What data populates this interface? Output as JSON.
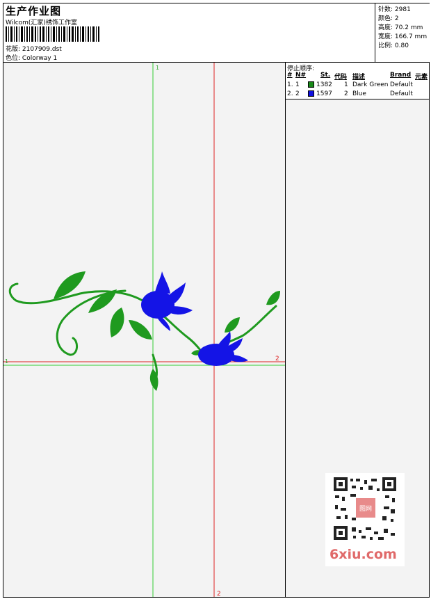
{
  "header": {
    "title": "生产作业图",
    "company": "Wilcom(汇家)绣饰工作室",
    "design_label": "花版:",
    "design_value": "2107909.dst",
    "colorway_label": "色位:",
    "colorway_value": "Colorway 1"
  },
  "stats": [
    {
      "label": "针数:",
      "value": "2981"
    },
    {
      "label": "颜色:",
      "value": "2"
    },
    {
      "label": "高度:",
      "value": "70.2 mm"
    },
    {
      "label": "宽度:",
      "value": "166.7 mm"
    },
    {
      "label": "比例:",
      "value": "0.80"
    }
  ],
  "stop_sequence": {
    "title": "停止顺序:",
    "headers": [
      "#",
      "N#",
      "St.",
      "代码",
      "描述",
      "Brand",
      "元素"
    ],
    "rows": [
      {
        "idx": "1.",
        "n": "1",
        "stitches": "1382",
        "code": "1",
        "desc": "Dark Green",
        "brand": "Default",
        "color": "#1a8a1a"
      },
      {
        "idx": "2.",
        "n": "2",
        "stitches": "1597",
        "code": "2",
        "desc": "Blue",
        "brand": "Default",
        "color": "#1010e0"
      }
    ]
  },
  "canvas": {
    "marker_top_1": "1",
    "marker_left_1": "1",
    "marker_right_2": "2",
    "marker_bottom_2": "2",
    "guide_green": "#33cc33",
    "guide_red": "#dd2222",
    "leaf_color": "#1f9a1f",
    "flower_color": "#1414e6"
  },
  "watermark": {
    "brand": "6xiu.com",
    "stamp": "图网"
  }
}
